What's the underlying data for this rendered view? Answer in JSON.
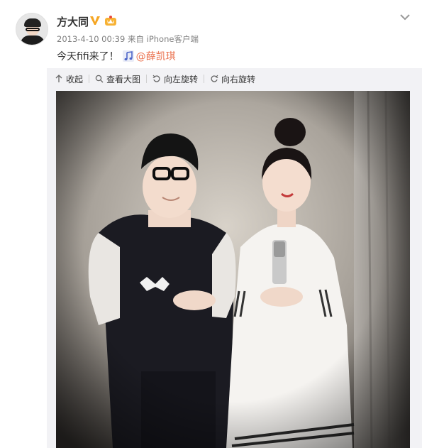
{
  "post": {
    "username": "方大同",
    "timestamp": "2013-4-10 00:39",
    "source_prefix": "来自",
    "source": "iPhone客户端",
    "text": "今天fifi来了！",
    "mention": "@薛凯琪"
  },
  "icons": {
    "verified": "verified-v-icon",
    "member": "member-crown-icon",
    "music": "music-note-icon",
    "menu": "chevron-down-icon"
  },
  "toolbar": {
    "collapse_label": "收起",
    "view_large_label": "查看大图",
    "rotate_left_label": "向左旋转",
    "rotate_right_label": "向右旋转"
  },
  "colors": {
    "accent": "#eb7350",
    "verified": "#f5a623",
    "panel": "#f2f2f5"
  }
}
